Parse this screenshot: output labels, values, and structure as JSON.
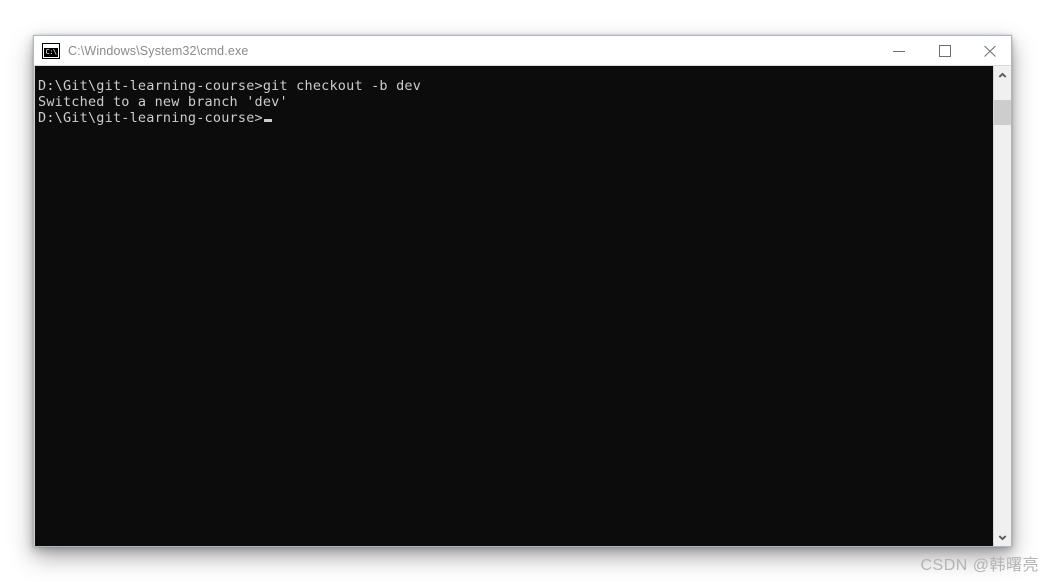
{
  "window": {
    "title": "C:\\Windows\\System32\\cmd.exe",
    "icon_name": "cmd-exe-icon",
    "icon_glyph": "C:\\",
    "controls": {
      "minimize_label": "Minimize",
      "maximize_label": "Maximize",
      "close_label": "Close"
    }
  },
  "console": {
    "background_color": "#0c0c0c",
    "text_color": "#cccccc",
    "lines": [
      "D:\\Git\\git-learning-course>git checkout -b dev",
      "Switched to a new branch 'dev'",
      "",
      "D:\\Git\\git-learning-course>"
    ],
    "cursor": {
      "visible": true,
      "style": "block"
    }
  },
  "scrollbar": {
    "up_arrow_label": "Scroll up",
    "down_arrow_label": "Scroll down",
    "thumb_label": "Scroll thumb"
  },
  "watermark": {
    "text": "CSDN @韩曙亮"
  }
}
